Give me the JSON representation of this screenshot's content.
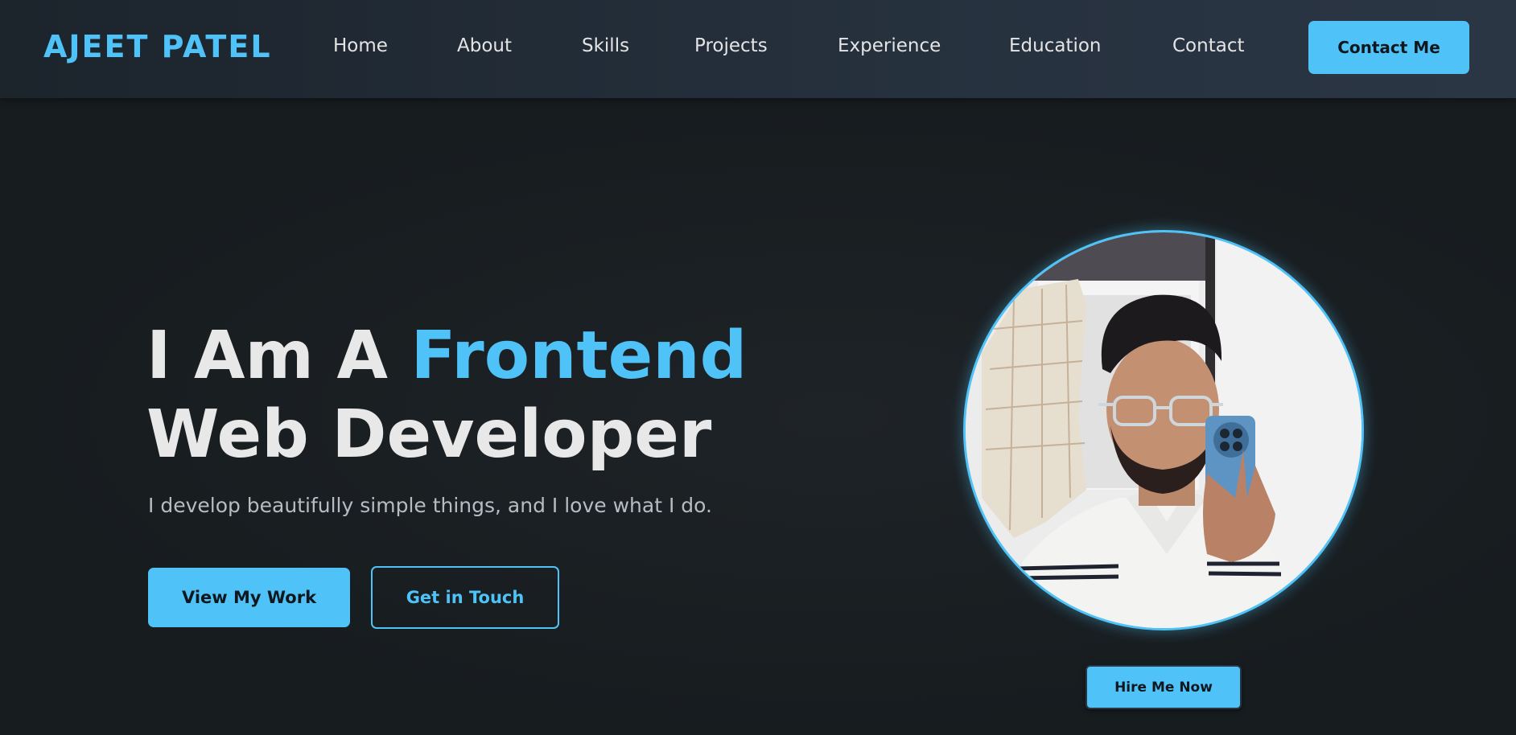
{
  "header": {
    "logo": "AJEET PATEL",
    "nav": [
      {
        "label": "Home"
      },
      {
        "label": "About"
      },
      {
        "label": "Skills"
      },
      {
        "label": "Projects"
      },
      {
        "label": "Experience"
      },
      {
        "label": "Education"
      },
      {
        "label": "Contact"
      }
    ],
    "cta_label": "Contact Me"
  },
  "hero": {
    "headline_prefix": "I Am A ",
    "headline_accent": "Frontend",
    "headline_line2": "Web Developer",
    "tagline": "I develop beautifully simple things, and I love what I do.",
    "primary_button": "View My Work",
    "secondary_button": "Get in Touch",
    "hire_button": "Hire Me Now"
  },
  "colors": {
    "accent": "#4fc3f7",
    "background": "#181d21",
    "navbar": "#26313e"
  }
}
